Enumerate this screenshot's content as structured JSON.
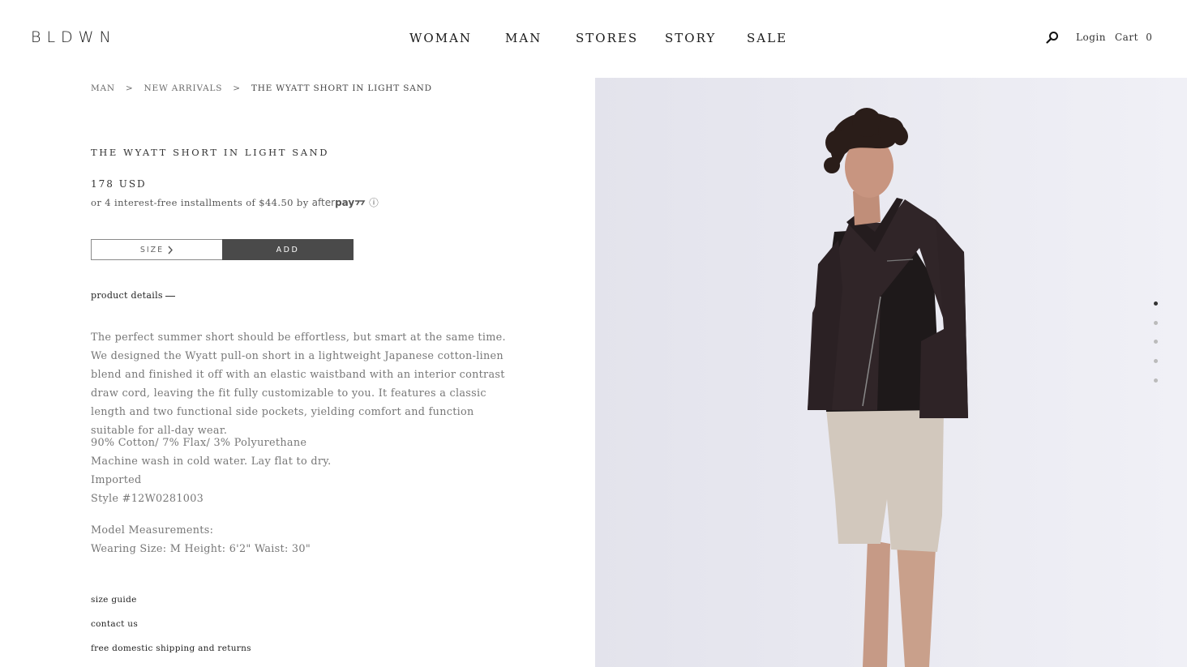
{
  "header": {
    "logo": "BLDWN",
    "nav": [
      "WOMAN",
      "MAN",
      "STORES",
      "STORY",
      "SALE"
    ],
    "login": "Login",
    "cart": "Cart",
    "cart_count": "0"
  },
  "breadcrumb": [
    "MAN",
    "NEW ARRIVALS",
    "THE WYATT SHORT IN LIGHT SAND"
  ],
  "breadcrumb_sep": ">",
  "product": {
    "title": "THE WYATT SHORT IN LIGHT SAND",
    "price": "178 USD",
    "afterpay_text": "or 4 interest-free installments of $44.50 by",
    "afterpay_logo_a": "after",
    "afterpay_logo_b": "pay",
    "info_icon": "ⓘ",
    "size_label": "SIZE",
    "add_label": "ADD",
    "details_toggle": "product details",
    "description": "The perfect summer short should be effortless, but smart at the same time. We designed the Wyatt pull-on short in a lightweight Japanese cotton-linen blend and finished it off with an elastic waistband with an interior contrast draw cord, leaving the fit fully customizable to you. It features a classic length and two functional side pockets, yielding comfort and function suitable for all-day wear.",
    "specs": [
      "90% Cotton/ 7% Flax/ 3% Polyurethane",
      "Machine wash in cold water. Lay flat to dry.",
      "Imported",
      "Style #12W0281003"
    ],
    "model": [
      "Model Measurements:",
      "Wearing Size: M Height: 6'2\" Waist: 30\""
    ],
    "links": [
      "size guide",
      "contact us",
      "free domestic shipping and returns"
    ]
  },
  "gallery": {
    "count": 5,
    "active": 1
  },
  "colors": {
    "add_button": "#4a4a4a",
    "photo_bg": "#e8e8f0"
  }
}
